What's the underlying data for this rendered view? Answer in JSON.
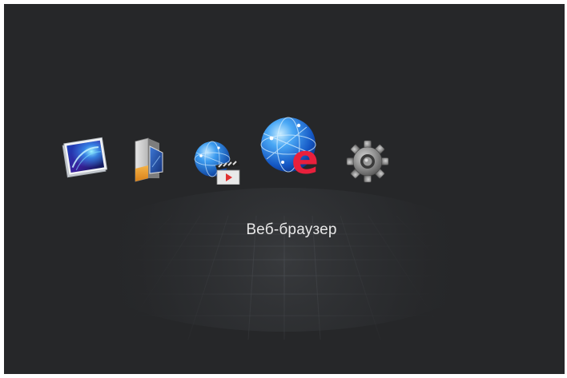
{
  "menu": {
    "selected_label": "Веб-браузер",
    "items": [
      {
        "icon": "photo-icon",
        "selected": false
      },
      {
        "icon": "music-icon",
        "selected": false
      },
      {
        "icon": "video-icon",
        "selected": false
      },
      {
        "icon": "web-browser-icon",
        "selected": true
      },
      {
        "icon": "settings-gear-icon",
        "selected": false
      }
    ]
  },
  "colors": {
    "background": "#262729",
    "label_text": "#e8e8e8",
    "browser_e": "#e8203c",
    "globe_blue": "#1f78d6"
  }
}
